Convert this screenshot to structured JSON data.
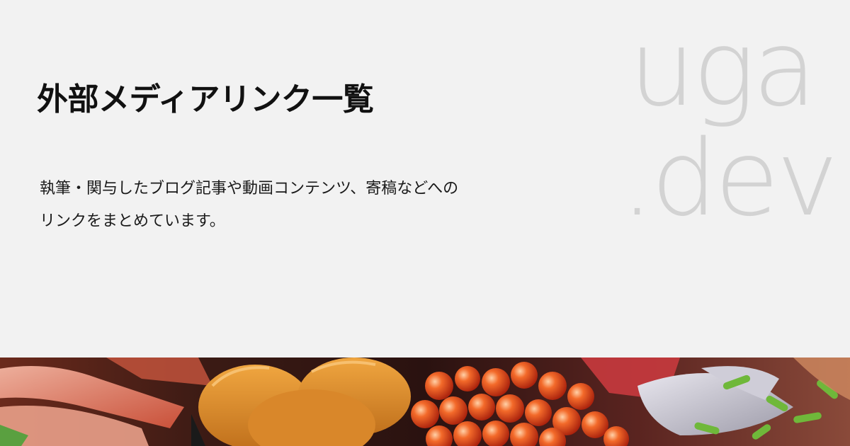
{
  "header": {
    "title": "外部メディアリンク一覧"
  },
  "description": {
    "line1": "執筆・関与したブログ記事や動画コンテンツ、寄稿などへの",
    "line2": "リンクをまとめています。"
  },
  "logo": {
    "line1": "uga",
    "line2": ".dev",
    "color": "#d3d3d3"
  },
  "banner": {
    "icon": "sushi-photo"
  },
  "colors": {
    "background": "#f2f2f2",
    "title": "#111111",
    "text": "#1a1a1a"
  }
}
